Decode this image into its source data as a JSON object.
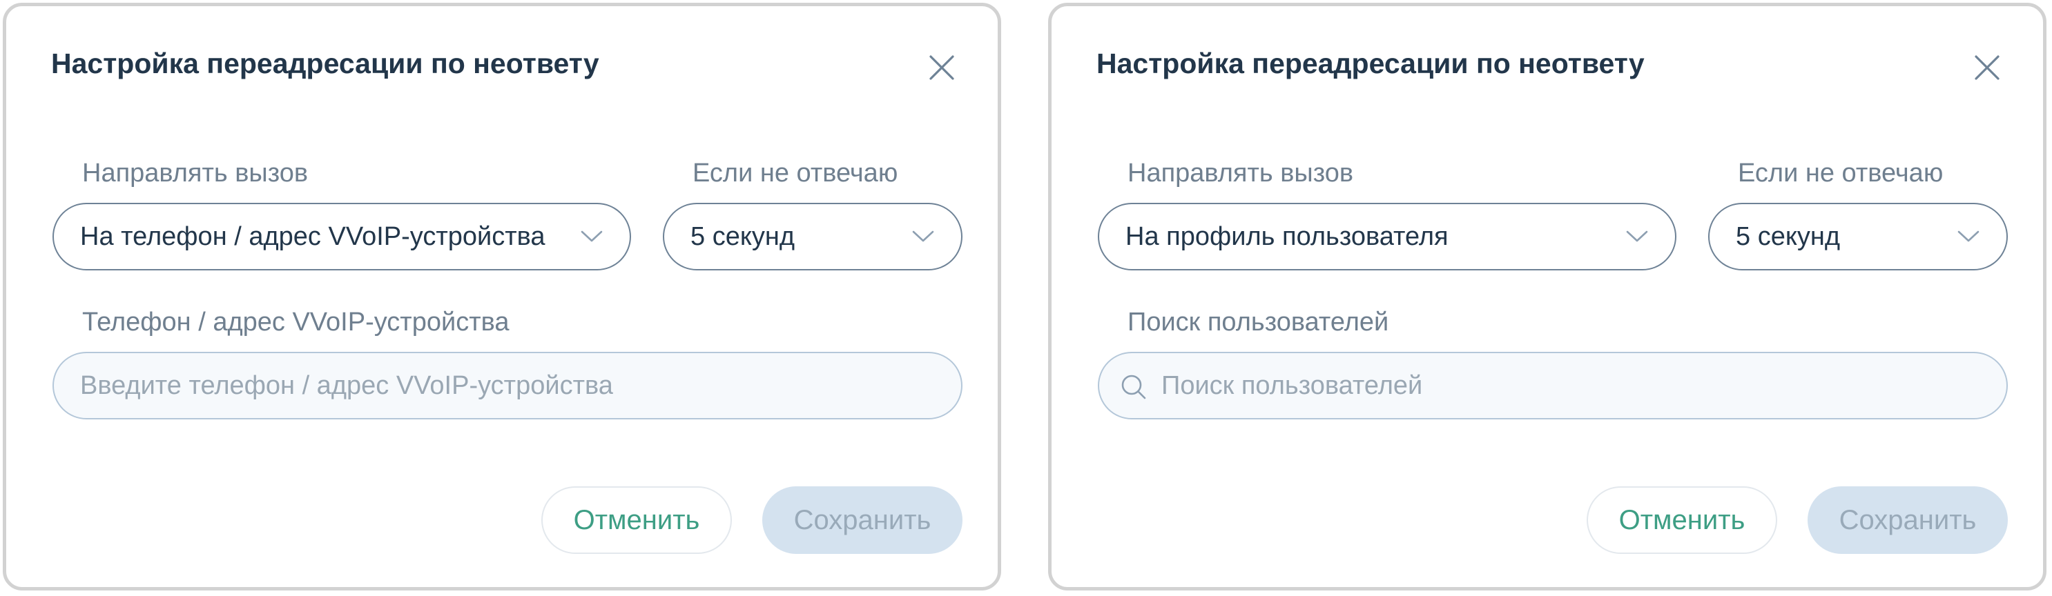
{
  "dialogs": [
    {
      "title": "Настройка переадресации по неответу",
      "forward_label": "Направлять вызов",
      "forward_value": "На телефон / адрес VVoIP-устройства",
      "delay_label": "Если не отвечаю",
      "delay_value": "5 секунд",
      "field_label": "Телефон / адрес VVoIP-устройства",
      "field_placeholder": "Введите телефон / адрес VVoIP-устройства",
      "field_icon": null,
      "cancel_label": "Отменить",
      "save_label": "Сохранить"
    },
    {
      "title": "Настройка переадресации по неответу",
      "forward_label": "Направлять вызов",
      "forward_value": "На профиль пользователя",
      "delay_label": "Если не отвечаю",
      "delay_value": "5 секунд",
      "field_label": "Поиск пользователей",
      "field_placeholder": "Поиск пользователей",
      "field_icon": "search-icon",
      "cancel_label": "Отменить",
      "save_label": "Сохранить"
    }
  ],
  "icons": {
    "close": "close-icon",
    "dropdown": "chevron-down-icon",
    "search": "search-icon"
  },
  "colors": {
    "title": "#22364a",
    "label": "#6f7f8f",
    "accent": "#3d9e84",
    "select_border": "#6e8296",
    "input_border": "#b4c7d9",
    "input_bg": "#f6f9fc",
    "save_disabled_bg": "#d4e2ef",
    "save_disabled_text": "#99aab9"
  }
}
